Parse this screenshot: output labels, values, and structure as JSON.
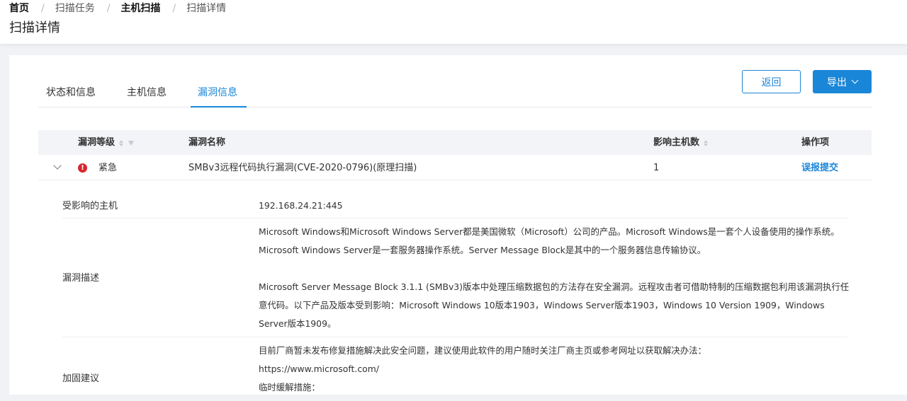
{
  "breadcrumb": {
    "items": [
      "首页",
      "扫描任务",
      "主机扫描",
      "扫描详情"
    ],
    "separator": "/"
  },
  "page": {
    "title": "扫描详情"
  },
  "tabs": [
    {
      "label": "状态和信息",
      "active": false
    },
    {
      "label": "主机信息",
      "active": false
    },
    {
      "label": "漏洞信息",
      "active": true
    }
  ],
  "actions": {
    "back_label": "返回",
    "export_label": "导出"
  },
  "table": {
    "headers": {
      "level": "漏洞等级",
      "name": "漏洞名称",
      "hosts": "影响主机数",
      "ops": "操作项"
    },
    "rows": [
      {
        "level": "紧急",
        "level_icon": "!",
        "name": "SMBv3远程代码执行漏洞(CVE-2020-0796)(原理扫描)",
        "hosts": "1",
        "action": "误报提交"
      }
    ]
  },
  "detail": {
    "affected_hosts_label": "受影响的主机",
    "affected_hosts_value": "192.168.24.21:445",
    "description_label": "漏洞描述",
    "description_p1": "Microsoft Windows和Microsoft Windows Server都是美国微软（Microsoft）公司的产品。Microsoft Windows是一套个人设备使用的操作系统。Microsoft Windows Server是一套服务器操作系统。Server Message Block是其中的一个服务器信息传输协议。",
    "description_p2": "Microsoft Server Message Block 3.1.1 (SMBv3)版本中处理压缩数据包的方法存在安全漏洞。远程攻击者可借助特制的压缩数据包利用该漏洞执行任意代码。以下产品及版本受到影响：Microsoft Windows 10版本1903，Windows Server版本1903，Windows 10 Version 1909，Windows Server版本1909。",
    "fix_label": "加固建议",
    "fix_p1": "目前厂商暂未发布修复措施解决此安全问题，建议使用此软件的用户随时关注厂商主页或参考网址以获取解决办法：",
    "fix_url": "https://www.microsoft.com/",
    "fix_p2": "临时缓解措施："
  },
  "colors": {
    "accent": "#1a86d8",
    "critical": "#d9262e"
  }
}
